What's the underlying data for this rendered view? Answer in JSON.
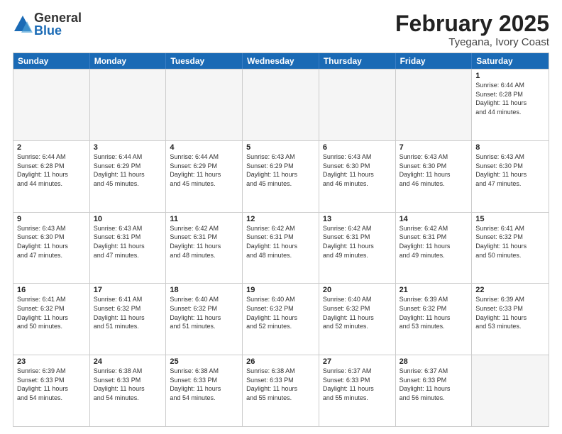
{
  "logo": {
    "general": "General",
    "blue": "Blue"
  },
  "title": {
    "month_year": "February 2025",
    "location": "Tyegana, Ivory Coast"
  },
  "weekdays": [
    "Sunday",
    "Monday",
    "Tuesday",
    "Wednesday",
    "Thursday",
    "Friday",
    "Saturday"
  ],
  "weeks": [
    [
      {
        "day": "",
        "text": "",
        "empty": true
      },
      {
        "day": "",
        "text": "",
        "empty": true
      },
      {
        "day": "",
        "text": "",
        "empty": true
      },
      {
        "day": "",
        "text": "",
        "empty": true
      },
      {
        "day": "",
        "text": "",
        "empty": true
      },
      {
        "day": "",
        "text": "",
        "empty": true
      },
      {
        "day": "1",
        "text": "Sunrise: 6:44 AM\nSunset: 6:28 PM\nDaylight: 11 hours\nand 44 minutes.",
        "empty": false
      }
    ],
    [
      {
        "day": "2",
        "text": "Sunrise: 6:44 AM\nSunset: 6:28 PM\nDaylight: 11 hours\nand 44 minutes.",
        "empty": false
      },
      {
        "day": "3",
        "text": "Sunrise: 6:44 AM\nSunset: 6:29 PM\nDaylight: 11 hours\nand 45 minutes.",
        "empty": false
      },
      {
        "day": "4",
        "text": "Sunrise: 6:44 AM\nSunset: 6:29 PM\nDaylight: 11 hours\nand 45 minutes.",
        "empty": false
      },
      {
        "day": "5",
        "text": "Sunrise: 6:43 AM\nSunset: 6:29 PM\nDaylight: 11 hours\nand 45 minutes.",
        "empty": false
      },
      {
        "day": "6",
        "text": "Sunrise: 6:43 AM\nSunset: 6:30 PM\nDaylight: 11 hours\nand 46 minutes.",
        "empty": false
      },
      {
        "day": "7",
        "text": "Sunrise: 6:43 AM\nSunset: 6:30 PM\nDaylight: 11 hours\nand 46 minutes.",
        "empty": false
      },
      {
        "day": "8",
        "text": "Sunrise: 6:43 AM\nSunset: 6:30 PM\nDaylight: 11 hours\nand 47 minutes.",
        "empty": false
      }
    ],
    [
      {
        "day": "9",
        "text": "Sunrise: 6:43 AM\nSunset: 6:30 PM\nDaylight: 11 hours\nand 47 minutes.",
        "empty": false
      },
      {
        "day": "10",
        "text": "Sunrise: 6:43 AM\nSunset: 6:31 PM\nDaylight: 11 hours\nand 47 minutes.",
        "empty": false
      },
      {
        "day": "11",
        "text": "Sunrise: 6:42 AM\nSunset: 6:31 PM\nDaylight: 11 hours\nand 48 minutes.",
        "empty": false
      },
      {
        "day": "12",
        "text": "Sunrise: 6:42 AM\nSunset: 6:31 PM\nDaylight: 11 hours\nand 48 minutes.",
        "empty": false
      },
      {
        "day": "13",
        "text": "Sunrise: 6:42 AM\nSunset: 6:31 PM\nDaylight: 11 hours\nand 49 minutes.",
        "empty": false
      },
      {
        "day": "14",
        "text": "Sunrise: 6:42 AM\nSunset: 6:31 PM\nDaylight: 11 hours\nand 49 minutes.",
        "empty": false
      },
      {
        "day": "15",
        "text": "Sunrise: 6:41 AM\nSunset: 6:32 PM\nDaylight: 11 hours\nand 50 minutes.",
        "empty": false
      }
    ],
    [
      {
        "day": "16",
        "text": "Sunrise: 6:41 AM\nSunset: 6:32 PM\nDaylight: 11 hours\nand 50 minutes.",
        "empty": false
      },
      {
        "day": "17",
        "text": "Sunrise: 6:41 AM\nSunset: 6:32 PM\nDaylight: 11 hours\nand 51 minutes.",
        "empty": false
      },
      {
        "day": "18",
        "text": "Sunrise: 6:40 AM\nSunset: 6:32 PM\nDaylight: 11 hours\nand 51 minutes.",
        "empty": false
      },
      {
        "day": "19",
        "text": "Sunrise: 6:40 AM\nSunset: 6:32 PM\nDaylight: 11 hours\nand 52 minutes.",
        "empty": false
      },
      {
        "day": "20",
        "text": "Sunrise: 6:40 AM\nSunset: 6:32 PM\nDaylight: 11 hours\nand 52 minutes.",
        "empty": false
      },
      {
        "day": "21",
        "text": "Sunrise: 6:39 AM\nSunset: 6:32 PM\nDaylight: 11 hours\nand 53 minutes.",
        "empty": false
      },
      {
        "day": "22",
        "text": "Sunrise: 6:39 AM\nSunset: 6:33 PM\nDaylight: 11 hours\nand 53 minutes.",
        "empty": false
      }
    ],
    [
      {
        "day": "23",
        "text": "Sunrise: 6:39 AM\nSunset: 6:33 PM\nDaylight: 11 hours\nand 54 minutes.",
        "empty": false
      },
      {
        "day": "24",
        "text": "Sunrise: 6:38 AM\nSunset: 6:33 PM\nDaylight: 11 hours\nand 54 minutes.",
        "empty": false
      },
      {
        "day": "25",
        "text": "Sunrise: 6:38 AM\nSunset: 6:33 PM\nDaylight: 11 hours\nand 54 minutes.",
        "empty": false
      },
      {
        "day": "26",
        "text": "Sunrise: 6:38 AM\nSunset: 6:33 PM\nDaylight: 11 hours\nand 55 minutes.",
        "empty": false
      },
      {
        "day": "27",
        "text": "Sunrise: 6:37 AM\nSunset: 6:33 PM\nDaylight: 11 hours\nand 55 minutes.",
        "empty": false
      },
      {
        "day": "28",
        "text": "Sunrise: 6:37 AM\nSunset: 6:33 PM\nDaylight: 11 hours\nand 56 minutes.",
        "empty": false
      },
      {
        "day": "",
        "text": "",
        "empty": true
      }
    ]
  ]
}
